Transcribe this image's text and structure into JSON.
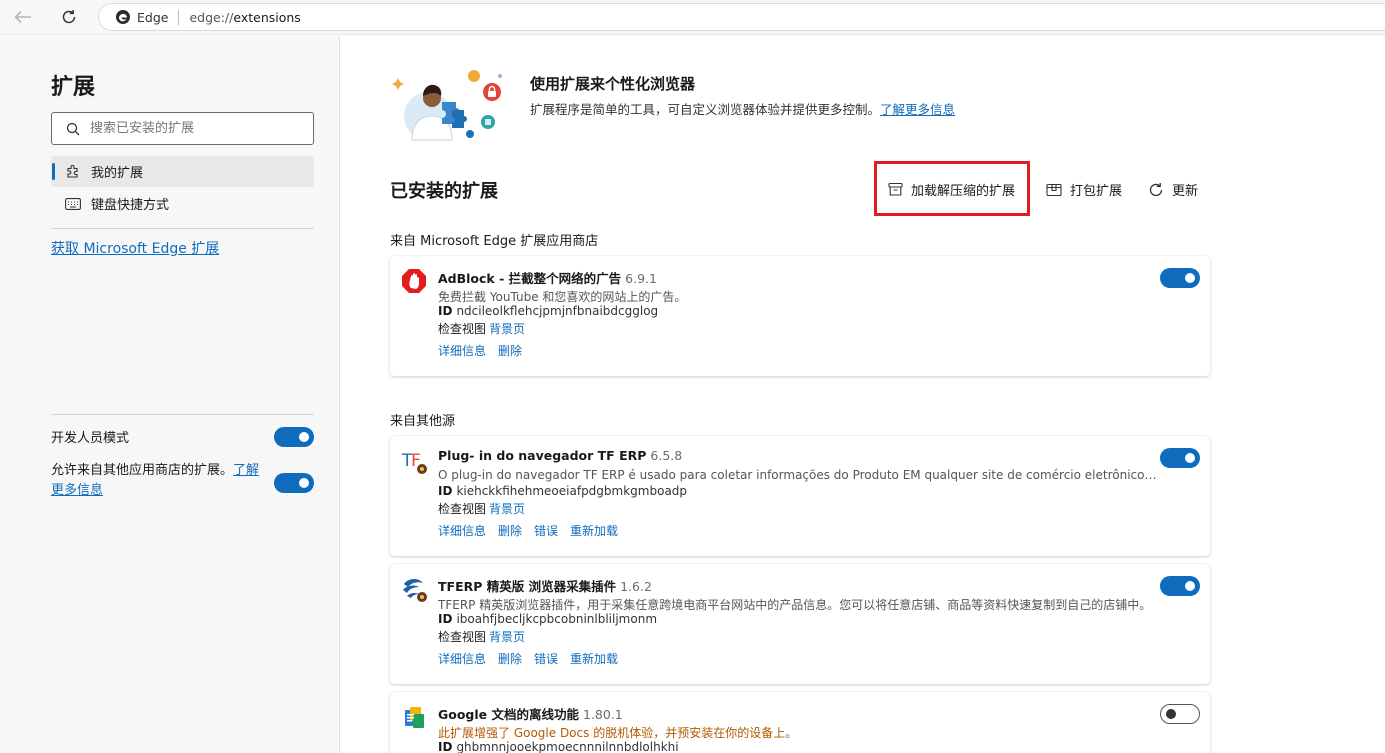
{
  "browser": {
    "site_name": "Edge",
    "url_prefix": "edge://",
    "url_path": "extensions"
  },
  "sidebar": {
    "title": "扩展",
    "search_placeholder": "搜索已安装的扩展",
    "items": [
      {
        "label": "我的扩展",
        "icon": "puzzle-icon",
        "active": true
      },
      {
        "label": "键盘快捷方式",
        "icon": "keyboard-icon",
        "active": false
      }
    ],
    "get_extensions_link": "获取 Microsoft Edge 扩展",
    "developer_mode_label": "开发人员模式",
    "developer_mode_on": true,
    "allow_other_stores_label": "允许来自其他应用商店的扩展。",
    "allow_other_stores_link": "了解更多信息",
    "allow_other_stores_on": true
  },
  "hero": {
    "title": "使用扩展来个性化浏览器",
    "description": "扩展程序是简单的工具，可自定义浏览器体验并提供更多控制。",
    "learn_more": "了解更多信息"
  },
  "installed": {
    "title": "已安装的扩展",
    "actions": [
      {
        "label": "加载解压缩的扩展",
        "icon": "unpacked-box-icon"
      },
      {
        "label": "打包扩展",
        "icon": "package-icon"
      },
      {
        "label": "更新",
        "icon": "refresh-icon"
      }
    ]
  },
  "sections": [
    {
      "label": "来自 Microsoft Edge 扩展应用商店",
      "extensions": [
        {
          "name": "AdBlock - 拦截整个网络的广告",
          "version": "6.9.1",
          "description": "免费拦截 YouTube 和您喜欢的网站上的广告。",
          "id_label": "ID",
          "id": "ndcileolkflehcjpmjnfbnaibdcgglog",
          "inspect_label": "检查视图",
          "inspect_link": "背景页",
          "links": [
            "详细信息",
            "删除"
          ],
          "enabled": true,
          "icon": "adblock-icon"
        }
      ]
    },
    {
      "label": "来自其他源",
      "extensions": [
        {
          "name": "Plug- in do navegador TF ERP",
          "version": "6.5.8",
          "description": "O plug-in do navegador TF ERP é usado para coletar informações do Produto EM qualquer site de comércio eletrônico tran...",
          "id_label": "ID",
          "id": "kiehckkfihehmeoeiafpdgbmkgmboadp",
          "inspect_label": "检查视图",
          "inspect_link": "背景页",
          "links": [
            "详细信息",
            "删除",
            "错误",
            "重新加载"
          ],
          "enabled": true,
          "icon": "tf-logo-icon"
        },
        {
          "name": "TFERP 精英版 浏览器采集插件",
          "version": "1.6.2",
          "description": "TFERP 精英版浏览器插件，用于采集任意跨境电商平台网站中的产品信息。您可以将任意店铺、商品等资料快速复制到自己的店铺中。",
          "id_label": "ID",
          "id": "iboahfjbecljkcpbcobninlbliljmonm",
          "inspect_label": "检查视图",
          "inspect_link": "背景页",
          "links": [
            "详细信息",
            "删除",
            "错误",
            "重新加载"
          ],
          "enabled": true,
          "icon": "tferp-globe-icon"
        },
        {
          "name": "Google 文档的离线功能",
          "version": "1.80.1",
          "description": "此扩展增强了 Google Docs 的脱机体验，并预安装在你的设备上。",
          "id_label": "ID",
          "id": "ghbmnnjooekpmoecnnnilnnbdlolhkhi",
          "enabled": false,
          "icon": "google-docs-icon"
        }
      ]
    }
  ],
  "colors": {
    "accent": "#0f6cbd",
    "highlight": "#e11c22",
    "warning_text": "#b35900"
  }
}
